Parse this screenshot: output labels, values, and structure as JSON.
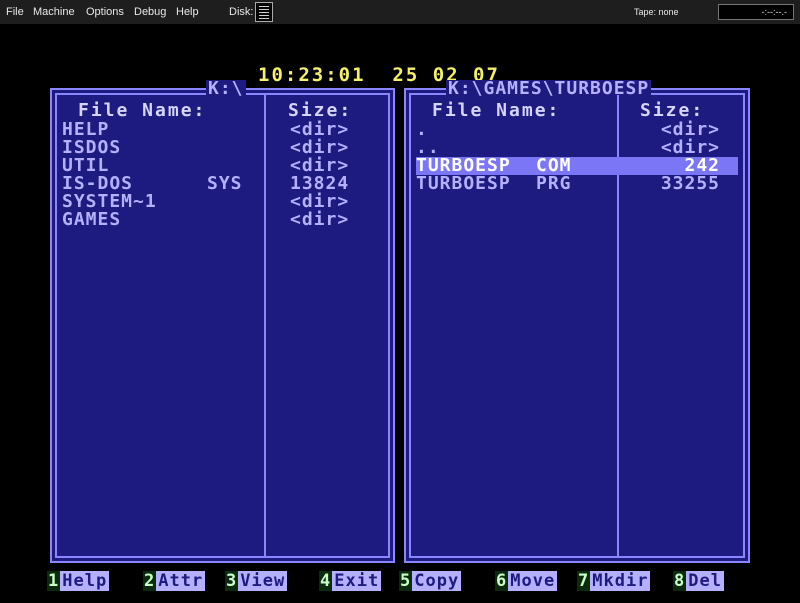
{
  "menubar": {
    "items": [
      "File",
      "Machine",
      "Options",
      "Debug",
      "Help"
    ],
    "disk_label": "Disk:",
    "tape_label": "Tape: none",
    "tape_counter": "-:--:--.-"
  },
  "clock": {
    "time": "10:23:01",
    "date": "25 02 07"
  },
  "left_panel": {
    "path": "K:\\",
    "header_name": "File Name:",
    "header_size": "Size:",
    "files": [
      {
        "name": "HELP",
        "ext": "",
        "size": "<dir>"
      },
      {
        "name": "ISDOS",
        "ext": "",
        "size": "<dir>"
      },
      {
        "name": "UTIL",
        "ext": "",
        "size": "<dir>"
      },
      {
        "name": "IS-DOS",
        "ext": "SYS",
        "size": "13824"
      },
      {
        "name": "SYSTEM~1",
        "ext": "",
        "size": "<dir>"
      },
      {
        "name": "GAMES",
        "ext": "",
        "size": "<dir>"
      }
    ]
  },
  "right_panel": {
    "path": "K:\\GAMES\\TURBOESP",
    "header_name": "File Name:",
    "header_size": "Size:",
    "files": [
      {
        "name": ".",
        "ext": "",
        "size": "<dir>"
      },
      {
        "name": "..",
        "ext": "",
        "size": "<dir>"
      },
      {
        "name": "TURBOESP",
        "ext": "COM",
        "size": "242",
        "selected": true
      },
      {
        "name": "TURBOESP",
        "ext": "PRG",
        "size": "33255"
      }
    ]
  },
  "function_keys": [
    {
      "num": "1",
      "label": "Help"
    },
    {
      "num": "2",
      "label": "Attr"
    },
    {
      "num": "3",
      "label": "View"
    },
    {
      "num": "4",
      "label": "Exit"
    },
    {
      "num": "5",
      "label": "Copy"
    },
    {
      "num": "6",
      "label": "Move"
    },
    {
      "num": "7",
      "label": "Mkdir"
    },
    {
      "num": "8",
      "label": "Del"
    }
  ],
  "colors": {
    "panel_bg": "#1d1b80",
    "panel_border": "#8a86ff",
    "text": "#b4b0ff",
    "selection": "#7b76f5",
    "clock": "#f4f06a"
  }
}
